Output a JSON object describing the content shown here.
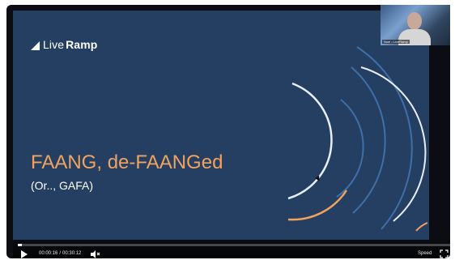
{
  "slide": {
    "logo_light": "Live",
    "logo_bold": "Ramp",
    "title": "FAANG, de-FAANGed",
    "subtitle": "(Or.., GAFA)"
  },
  "webcam": {
    "name_tag": "Noel • LiveRamp"
  },
  "player": {
    "current_time": "00:00:16",
    "separator": "/",
    "total_time": "00:30:12",
    "speed_label": "Speed",
    "progress": 0.009
  },
  "colors": {
    "slide_background": "#243f62",
    "title_orange": "#f0a35e",
    "arc_white": "#e8eef6",
    "arc_blue": "#3f6fa8"
  },
  "icons": [
    "play-icon",
    "volume-icon",
    "fullscreen-icon",
    "liveramp-logo-icon"
  ]
}
